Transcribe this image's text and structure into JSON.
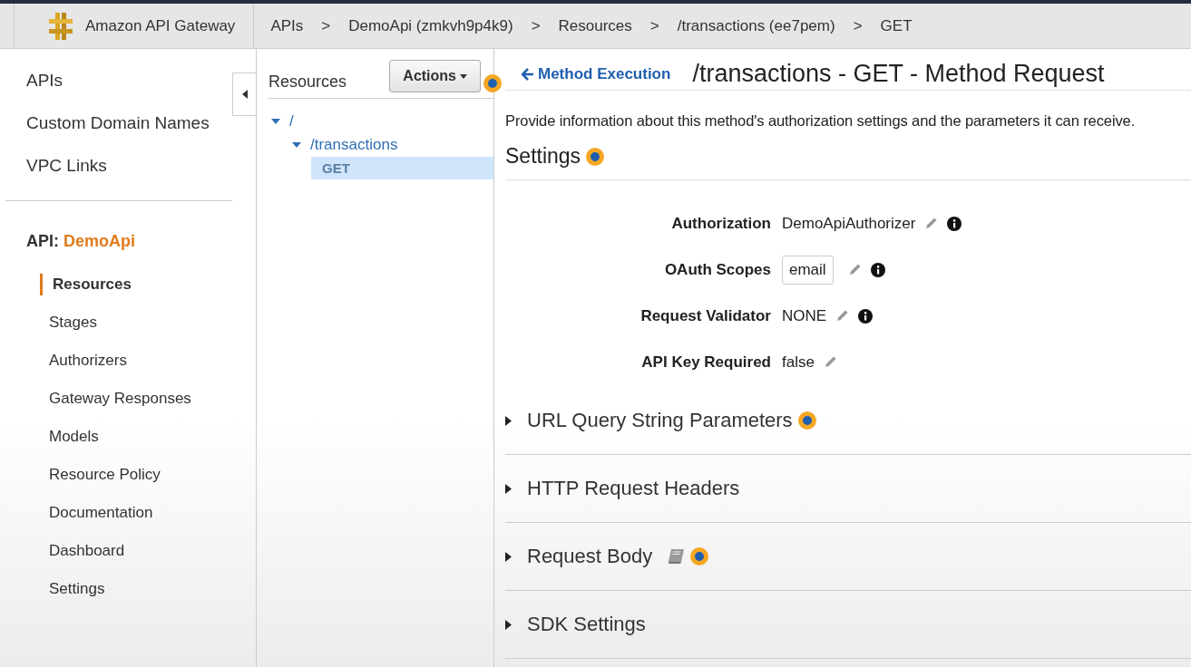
{
  "header": {
    "product": "Amazon API Gateway",
    "breadcrumbs": [
      "APIs",
      "DemoApi (zmkvh9p4k9)",
      "Resources",
      "/transactions (ee7pem)",
      "GET"
    ],
    "separator": ">"
  },
  "sidebar": {
    "top_items": [
      "APIs",
      "Custom Domain Names",
      "VPC Links"
    ],
    "api_label": "API:",
    "api_name": "DemoApi",
    "items": [
      {
        "label": "Resources",
        "selected": true
      },
      {
        "label": "Stages",
        "selected": false
      },
      {
        "label": "Authorizers",
        "selected": false
      },
      {
        "label": "Gateway Responses",
        "selected": false
      },
      {
        "label": "Models",
        "selected": false
      },
      {
        "label": "Resource Policy",
        "selected": false
      },
      {
        "label": "Documentation",
        "selected": false
      },
      {
        "label": "Dashboard",
        "selected": false
      },
      {
        "label": "Settings",
        "selected": false
      }
    ]
  },
  "resources": {
    "title": "Resources",
    "actions_button": "Actions",
    "actions_hotspot": true,
    "tree": [
      {
        "label": "/",
        "kind": "resource",
        "expanded": true,
        "selected": false,
        "children": [
          {
            "label": "/transactions",
            "kind": "resource",
            "expanded": true,
            "selected": false,
            "children": [
              {
                "label": "GET",
                "kind": "method",
                "selected": true
              }
            ]
          }
        ]
      }
    ]
  },
  "main": {
    "back_link": "Method Execution",
    "title": "/transactions - GET - Method Request",
    "description": "Provide information about this method's authorization settings and the parameters it can receive.",
    "settings_heading": "Settings",
    "settings_hotspot": true,
    "settings": [
      {
        "label": "Authorization",
        "value": "DemoApiAuthorizer",
        "kind": "text",
        "editable": true,
        "info": true
      },
      {
        "label": "OAuth Scopes",
        "value": "email",
        "kind": "tag",
        "editable": true,
        "info": true
      },
      {
        "label": "Request Validator",
        "value": "NONE",
        "kind": "text",
        "editable": true,
        "info": true
      },
      {
        "label": "API Key Required",
        "value": "false",
        "kind": "text",
        "editable": true,
        "info": false
      }
    ],
    "sections": [
      {
        "title": "URL Query String Parameters",
        "expanded": false,
        "hotspot": true,
        "doc_icon": false
      },
      {
        "title": "HTTP Request Headers",
        "expanded": false,
        "hotspot": false,
        "doc_icon": false
      },
      {
        "title": "Request Body",
        "expanded": false,
        "hotspot": true,
        "doc_icon": true
      },
      {
        "title": "SDK Settings",
        "expanded": false,
        "hotspot": false,
        "doc_icon": false
      }
    ]
  }
}
